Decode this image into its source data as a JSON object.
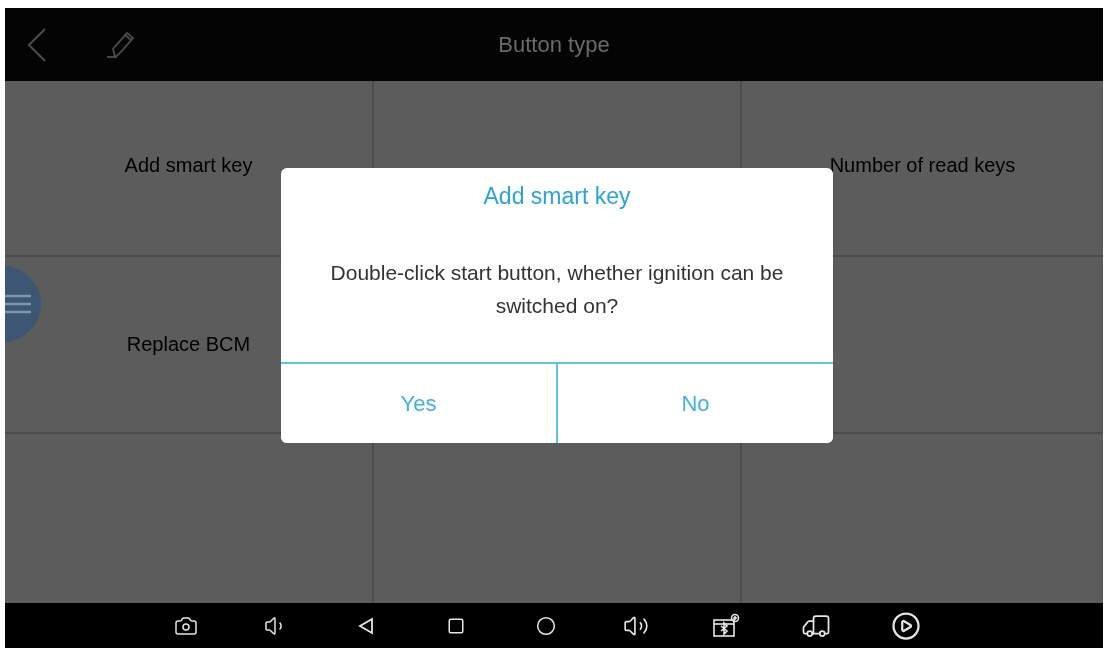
{
  "top_bar": {
    "title": "Button type"
  },
  "cells": [
    {
      "label": "Add smart key"
    },
    {},
    {
      "label": "Number of read keys"
    },
    {
      "label": "Replace BCM"
    },
    {},
    {},
    {},
    {},
    {}
  ],
  "dialog": {
    "title": "Add smart key",
    "message": "Double-click start button, whether ignition can be switched on?",
    "buttons": [
      "Yes",
      "No"
    ]
  }
}
